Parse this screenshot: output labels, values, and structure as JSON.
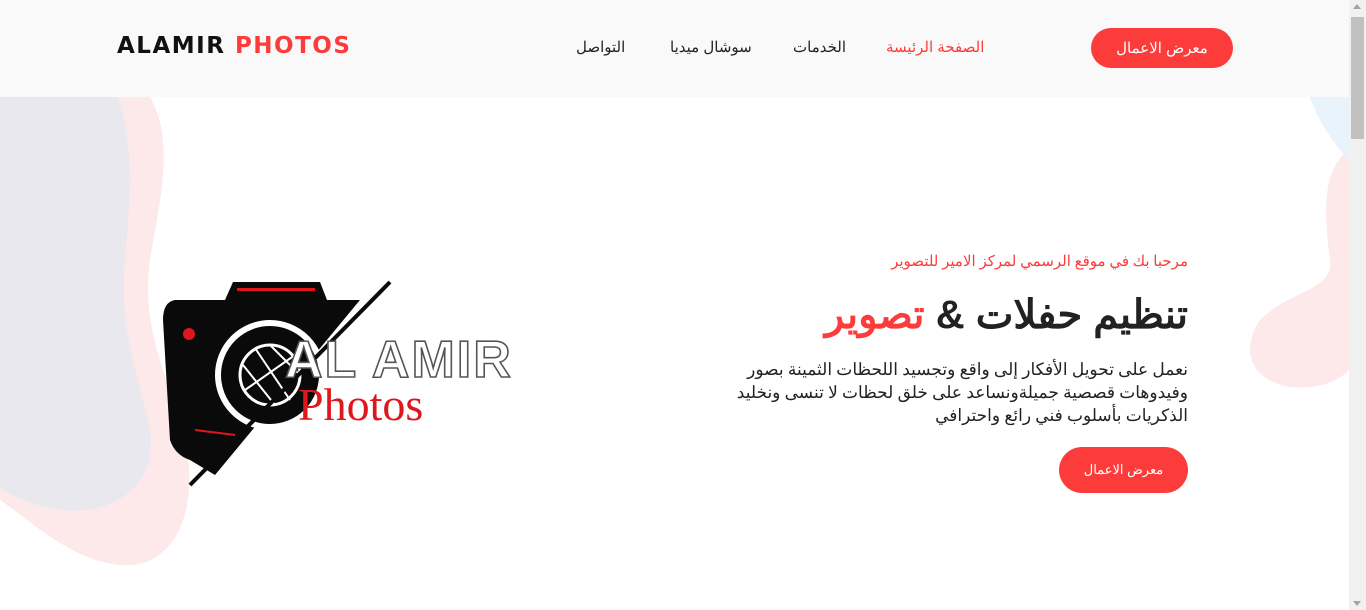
{
  "brand": {
    "name": "ALAMIR",
    "accent": "PHOTOS"
  },
  "nav": {
    "items": [
      {
        "label": "الصفحة الرئيسة",
        "active": true
      },
      {
        "label": "الخدمات",
        "active": false
      },
      {
        "label": "سوشال ميديا",
        "active": false
      },
      {
        "label": "التواصل",
        "active": false
      }
    ],
    "cta_label": "معرض الاعمال"
  },
  "hero": {
    "subtitle": "مرحبا بك في موقع الرسمي لمركز الامير للتصوير",
    "title_main": "تنظيم حفلات &",
    "title_accent": "تصوير",
    "description": "نعمل على تحويل الأفكار إلى واقع وتجسيد اللحظات الثمينة بصور وفيدوهات قصصية جميلةونساعد على خلق لحظات لا تنسى ونخليد الذكريات بأسلوب فني رائع واحترافي",
    "button_label": "معرض الاعمال"
  },
  "logo": {
    "line1": "AL AMIR",
    "line2": "Photos"
  },
  "colors": {
    "accent": "#fc3b3b",
    "header_bg": "#f9f9f9",
    "blob_gray": "#e9e8ee",
    "blob_pink": "#fde8ea"
  },
  "icons": {
    "logo": "camera-aperture-icon"
  }
}
